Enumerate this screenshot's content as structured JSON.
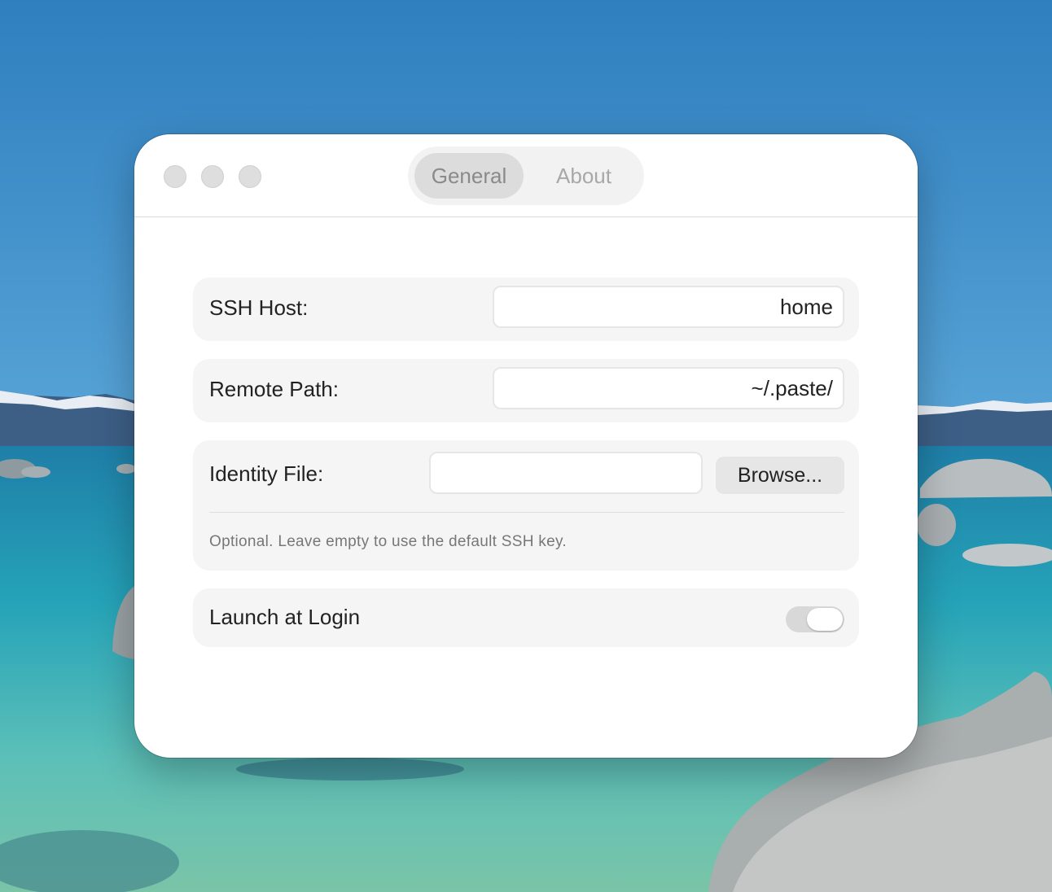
{
  "window": {
    "tabs": [
      {
        "label": "General",
        "selected": true
      },
      {
        "label": "About",
        "selected": false
      }
    ]
  },
  "form": {
    "ssh_host": {
      "label": "SSH Host:",
      "value": "home"
    },
    "remote_path": {
      "label": "Remote Path:",
      "value": "~/.paste/"
    },
    "identity_file": {
      "label": "Identity File:",
      "value": "",
      "browse_label": "Browse...",
      "hint": "Optional. Leave empty to use the default SSH key."
    },
    "launch_at_login": {
      "label": "Launch at Login",
      "enabled": false
    }
  },
  "icons": {
    "close": "close-icon",
    "minimize": "minimize-icon",
    "zoom": "zoom-icon"
  },
  "colors": {
    "window_bg": "#ffffff",
    "row_bg": "#f5f5f5",
    "selected_tab_bg": "#dcdcdc",
    "traffic_light_inactive": "#dedede"
  }
}
